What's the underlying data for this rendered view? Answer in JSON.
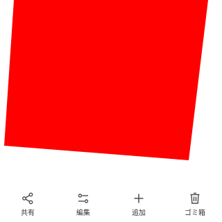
{
  "photo": {
    "fill_color": "#ff0000"
  },
  "toolbar": {
    "icon_color": "#4a4a4a",
    "items": [
      {
        "label": "共有",
        "icon": "share-icon"
      },
      {
        "label": "編集",
        "icon": "tune-icon"
      },
      {
        "label": "追加",
        "icon": "plus-icon"
      },
      {
        "label": "ゴミ箱",
        "icon": "trash-icon"
      }
    ]
  }
}
